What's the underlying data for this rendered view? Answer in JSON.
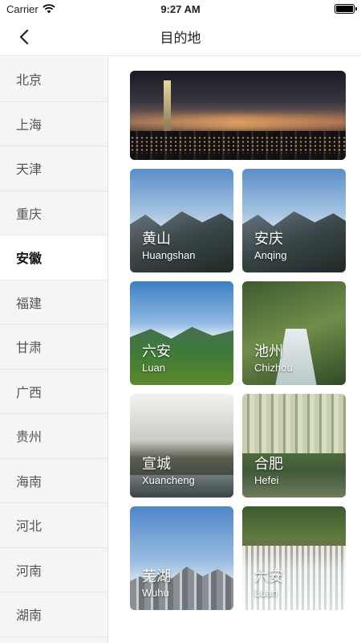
{
  "status": {
    "carrier": "Carrier",
    "time": "9:27 AM"
  },
  "nav": {
    "title": "目的地"
  },
  "sidebar": {
    "items": [
      "北京",
      "上海",
      "天津",
      "重庆",
      "安徽",
      "福建",
      "甘肃",
      "广西",
      "贵州",
      "海南",
      "河北",
      "河南",
      "湖南"
    ],
    "active_index": 4
  },
  "main": {
    "cards": [
      {
        "cn": "黄山",
        "en": "Huangshan"
      },
      {
        "cn": "安庆",
        "en": "Anqing"
      },
      {
        "cn": "六安",
        "en": "Luan"
      },
      {
        "cn": "池州",
        "en": "Chizhou"
      },
      {
        "cn": "宣城",
        "en": "Xuancheng"
      },
      {
        "cn": "合肥",
        "en": "Hefei"
      },
      {
        "cn": "芜湖",
        "en": "Wuhu"
      },
      {
        "cn": "六安",
        "en": "Luan"
      }
    ]
  },
  "colors": {
    "active_bg": "#ffffff",
    "sidebar_bg": "#f5f5f5",
    "divider": "#e5e5e5"
  }
}
